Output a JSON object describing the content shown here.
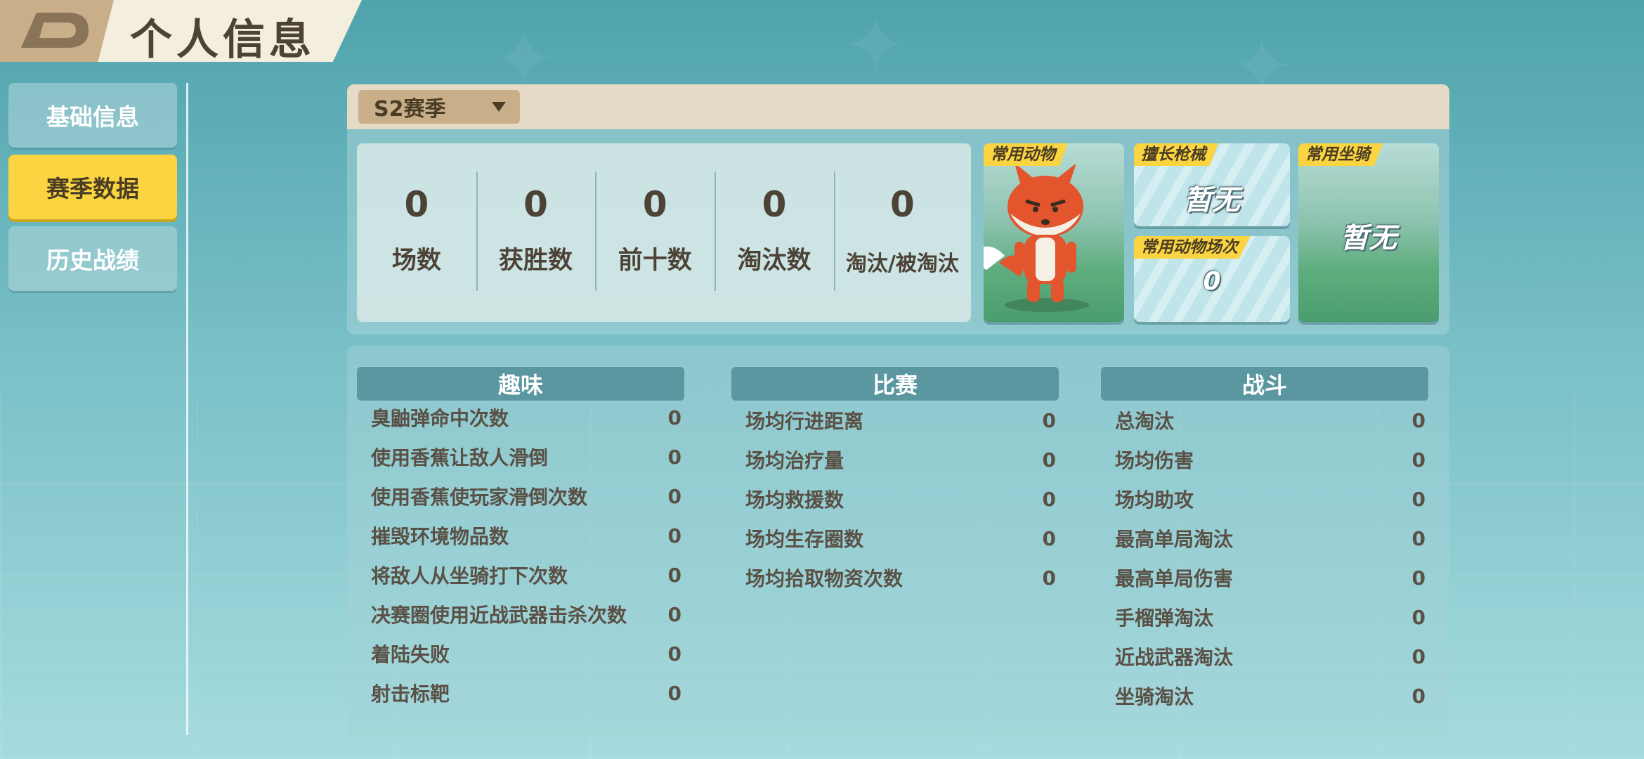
{
  "header": {
    "title": "个人信息"
  },
  "sidebar": {
    "items": [
      {
        "label": "基础信息"
      },
      {
        "label": "赛季数据"
      },
      {
        "label": "历史战绩"
      }
    ]
  },
  "season": {
    "selected": "S2赛季"
  },
  "stats": [
    {
      "value": "0",
      "label": "场数"
    },
    {
      "value": "0",
      "label": "获胜数"
    },
    {
      "value": "0",
      "label": "前十数"
    },
    {
      "value": "0",
      "label": "淘汰数"
    },
    {
      "value": "0",
      "label": "淘汰/被淘汰"
    }
  ],
  "cards": {
    "animal": {
      "tag": "常用动物"
    },
    "weapon": {
      "tag": "擅长枪械",
      "value": "暂无"
    },
    "animal_count": {
      "tag": "常用动物场次",
      "value": "0"
    },
    "mount": {
      "tag": "常用坐骑",
      "value": "暂无"
    }
  },
  "groups": {
    "fun": {
      "title": "趣味",
      "rows": [
        {
          "label": "臭鼬弹命中次数",
          "value": "0"
        },
        {
          "label": "使用香蕉让敌人滑倒",
          "value": "0"
        },
        {
          "label": "使用香蕉使玩家滑倒次数",
          "value": "0"
        },
        {
          "label": "摧毁环境物品数",
          "value": "0"
        },
        {
          "label": "将敌人从坐骑打下次数",
          "value": "0"
        },
        {
          "label": "决赛圈使用近战武器击杀次数",
          "value": "0"
        },
        {
          "label": "着陆失败",
          "value": "0"
        },
        {
          "label": "射击标靶",
          "value": "0"
        }
      ]
    },
    "match": {
      "title": "比赛",
      "rows": [
        {
          "label": "场均行进距离",
          "value": "0"
        },
        {
          "label": "场均治疗量",
          "value": "0"
        },
        {
          "label": "场均救援数",
          "value": "0"
        },
        {
          "label": "场均生存圈数",
          "value": "0"
        },
        {
          "label": "场均拾取物资次数",
          "value": "0"
        }
      ]
    },
    "combat": {
      "title": "战斗",
      "rows": [
        {
          "label": "总淘汰",
          "value": "0"
        },
        {
          "label": "场均伤害",
          "value": "0"
        },
        {
          "label": "场均助攻",
          "value": "0"
        },
        {
          "label": "最高单局淘汰",
          "value": "0"
        },
        {
          "label": "最高单局伤害",
          "value": "0"
        },
        {
          "label": "手榴弹淘汰",
          "value": "0"
        },
        {
          "label": "近战武器淘汰",
          "value": "0"
        },
        {
          "label": "坐骑淘汰",
          "value": "0"
        }
      ]
    }
  }
}
